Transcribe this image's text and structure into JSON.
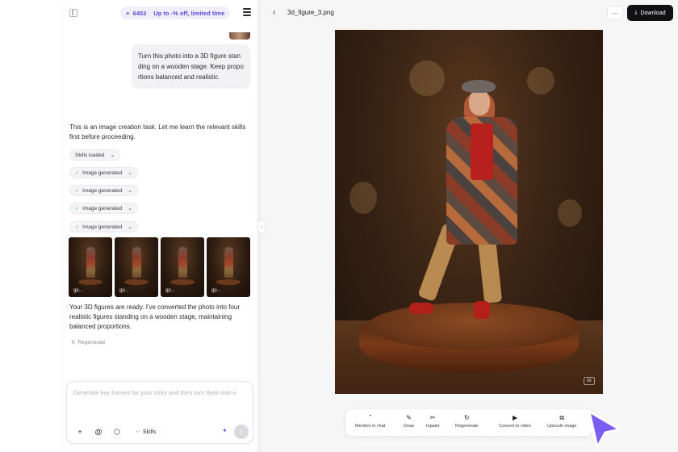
{
  "header": {
    "credits": "6453",
    "promo": "Up to -% off, limited time"
  },
  "chat": {
    "user_message": "Turn this photo into a 3D figure standing on a wooden stage. Keep proportions balanced and realistic.",
    "assistant_intro": "This is an image creation task. Let me learn the relevant skills first before proceeding.",
    "steps": [
      {
        "label": "Skills loaded",
        "checked": false
      },
      {
        "label": "Image generated",
        "checked": true
      },
      {
        "label": "Image generated",
        "checked": true
      },
      {
        "label": "Image generated",
        "checked": true
      },
      {
        "label": "Image generated",
        "checked": true
      }
    ],
    "results": [
      {
        "tag": "gp..."
      },
      {
        "tag": "gp..."
      },
      {
        "tag": "gp..."
      },
      {
        "tag": "gp..."
      }
    ],
    "summary": "Your 3D figures are ready. I've converted the photo into four realistic figures standing on a wooden stage, maintaining balanced proportions.",
    "regenerate_label": "Regenerate"
  },
  "composer": {
    "placeholder": "Generate key frames for your story and then turn them into a",
    "skills_label": "Skills"
  },
  "viewer": {
    "file_name": "3d_figure_3.png",
    "download_label": "Download",
    "ai_badge": "AI"
  },
  "tools": [
    {
      "label": "Mention in chat",
      "icon": "quote-icon",
      "glyph": "”"
    },
    {
      "label": "Draw",
      "icon": "pen-icon",
      "glyph": "✎"
    },
    {
      "label": "Inpaint",
      "icon": "scissors-icon",
      "glyph": "✂"
    },
    {
      "label": "Regenerate",
      "icon": "refresh-icon",
      "glyph": "↻"
    },
    {
      "label": "Convert to video",
      "icon": "video-icon",
      "glyph": "▶"
    },
    {
      "label": "Upscale image",
      "icon": "upscale-icon",
      "glyph": "⧉"
    }
  ],
  "colors": {
    "accent": "#5b4bdb",
    "cursor": "#7b5cf5",
    "check": "#3fb06b"
  }
}
